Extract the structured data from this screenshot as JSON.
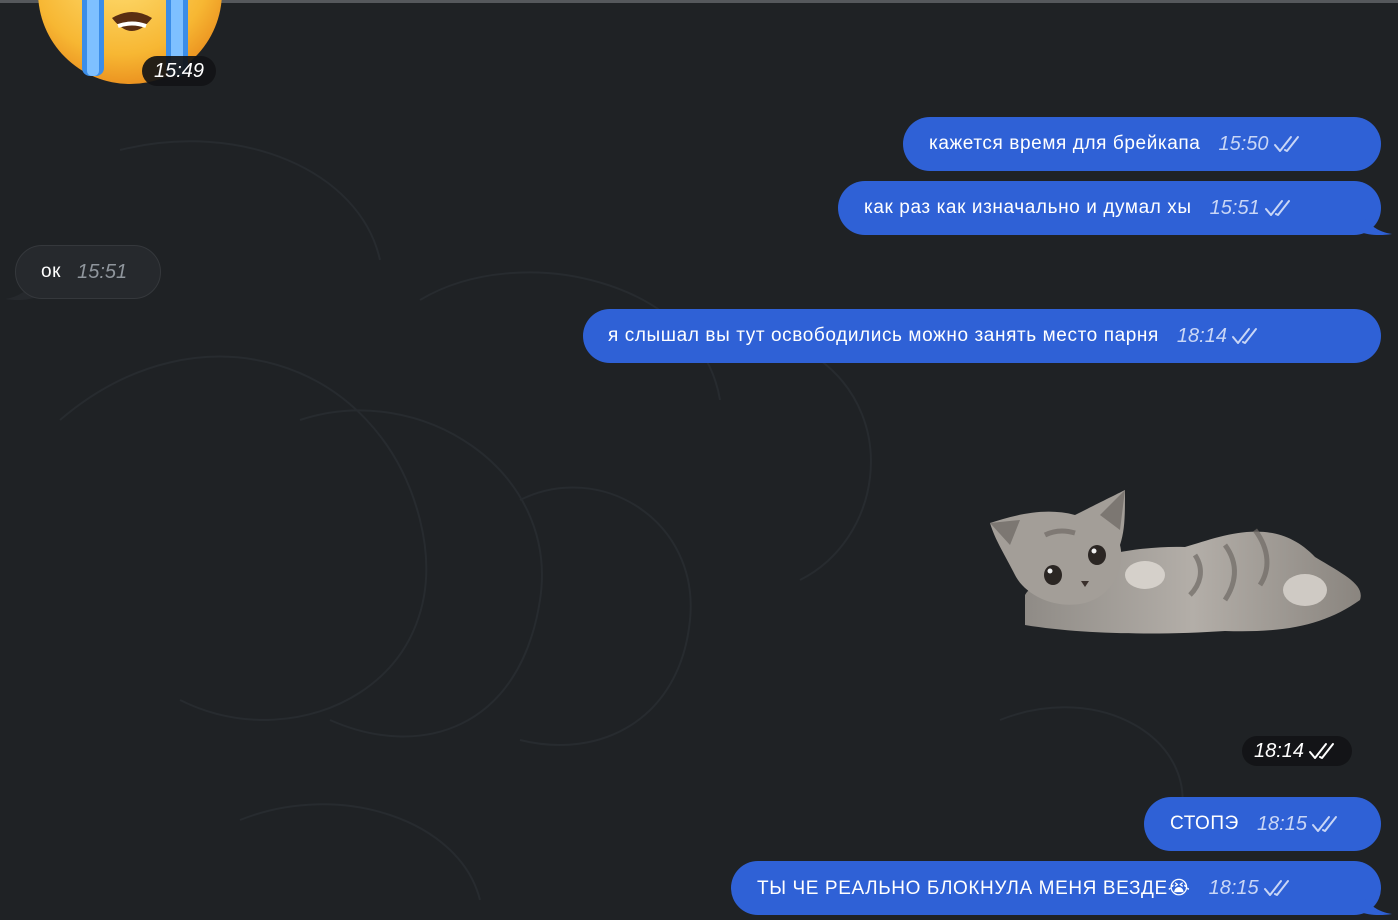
{
  "messages": [
    {
      "id": "m0",
      "type": "sticker",
      "direction": "in",
      "emoji": "😭",
      "time": "15:49"
    },
    {
      "id": "m1",
      "type": "text",
      "direction": "out",
      "text": "кажется время для брейкапа",
      "time": "15:50",
      "status": "read"
    },
    {
      "id": "m2",
      "type": "text",
      "direction": "out",
      "text": "как раз как изначально и думал хы",
      "time": "15:51",
      "status": "read"
    },
    {
      "id": "m3",
      "type": "text",
      "direction": "in",
      "text": "ок",
      "time": "15:51"
    },
    {
      "id": "m4",
      "type": "text",
      "direction": "out",
      "text": "я слышал вы тут освободились можно занять место парня",
      "time": "18:14",
      "status": "read"
    },
    {
      "id": "m5",
      "type": "sticker",
      "direction": "out",
      "sticker": "kitten",
      "time": "18:14",
      "status": "read"
    },
    {
      "id": "m6",
      "type": "text",
      "direction": "out",
      "text": "СТОПЭ",
      "time": "18:15",
      "status": "read"
    },
    {
      "id": "m7",
      "type": "text",
      "direction": "out",
      "text": "ТЫ ЧЕ РЕАЛЬНО БЛОКНУЛА МЕНЯ ВЕЗДЕ😭",
      "time": "18:15",
      "status": "read"
    }
  ],
  "colors": {
    "background": "#1f2225",
    "outgoing_bubble": "#2f61d6",
    "incoming_bubble": "#26292d"
  }
}
